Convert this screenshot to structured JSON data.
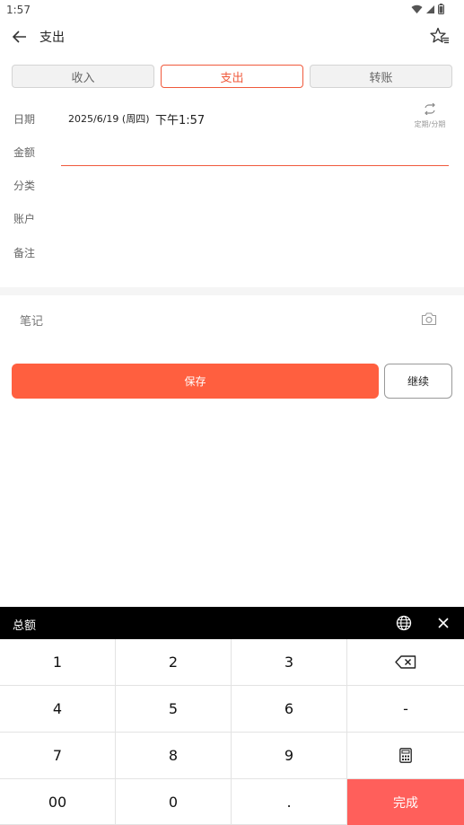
{
  "status_bar": {
    "time": "1:57",
    "icons": [
      "wifi-icon",
      "signal-icon",
      "battery-icon"
    ]
  },
  "app_bar": {
    "title": "支出",
    "back_icon": "arrow-left-icon",
    "action_icon": "star-list-icon"
  },
  "type_tabs": [
    {
      "label": "收入",
      "active": false
    },
    {
      "label": "支出",
      "active": true
    },
    {
      "label": "转账",
      "active": false
    }
  ],
  "form": {
    "date_label": "日期",
    "date_value": "2025/6/19 (周四)",
    "time_value": "下午1:57",
    "recurring_label": "定期/分期",
    "amount_label": "金额",
    "amount_value": "",
    "category_label": "分类",
    "account_label": "账户",
    "remark_label": "备注"
  },
  "note": {
    "label": "笔记",
    "camera_icon": "camera-icon"
  },
  "actions": {
    "save_label": "保存",
    "continue_label": "继续"
  },
  "keyboard": {
    "title": "总额",
    "keys": [
      [
        "1",
        "2",
        "3",
        "⌫"
      ],
      [
        "4",
        "5",
        "6",
        "-"
      ],
      [
        "7",
        "8",
        "9",
        "calc"
      ],
      [
        "00",
        "0",
        ".",
        "完成"
      ]
    ],
    "done_label": "完成"
  },
  "colors": {
    "accent": "#f05a3c",
    "save_button": "#ff5f3f",
    "done_key": "#ff5f5b",
    "keyboard_header": "#000000"
  }
}
